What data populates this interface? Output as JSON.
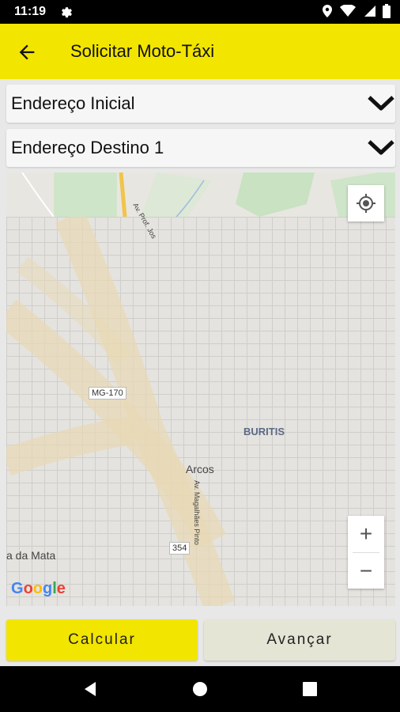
{
  "status_bar": {
    "time": "11:19"
  },
  "app_bar": {
    "title": "Solicitar Moto-Táxi"
  },
  "fields": {
    "start_label": "Endereço Inicial",
    "destination_label": "Endereço Destino 1"
  },
  "map": {
    "labels": {
      "road_code": "MG-170",
      "neighborhood": "BURITIS",
      "city": "Arcos",
      "street": "Av. Magalhães Pinto",
      "street_top": "Av. Prof. Jos",
      "route_number": "354",
      "town_partial": "a da Mata"
    },
    "zoom_in": "+",
    "zoom_out": "−",
    "logo": "Google"
  },
  "actions": {
    "calculate_label": "Calcular",
    "next_label": "Avançar"
  },
  "colors": {
    "accent_yellow": "#f2e500",
    "secondary_button": "#e5e5d6"
  }
}
